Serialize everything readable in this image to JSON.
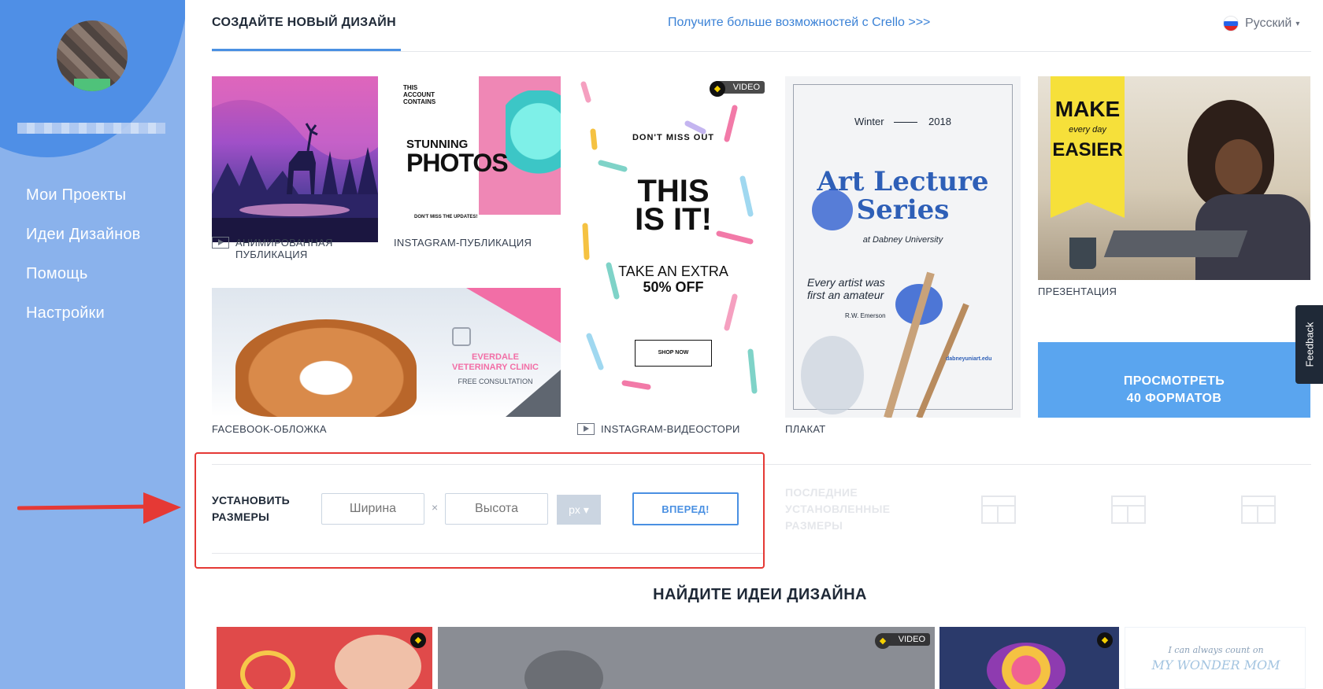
{
  "sidebar": {
    "nav": [
      "Мои Проекты",
      "Идеи Дизайнов",
      "Помощь",
      "Настройки"
    ]
  },
  "header": {
    "tab_label": "СОЗДАЙТЕ НОВЫЙ ДИЗАЙН",
    "upgrade_link": "Получите больше возможностей с Crello >>>",
    "language": "Русский"
  },
  "templates": {
    "animated": {
      "caption_line1": "АНИМИРОВАННАЯ",
      "caption_line2": "ПУБЛИКАЦИЯ"
    },
    "instagram": {
      "caption": "INSTAGRAM-ПУБЛИКАЦИЯ",
      "text_small": "THIS ACCOUNT CONTAINS",
      "text_stunning": "STUNNING",
      "text_photos": "PHOTOS",
      "text_footer": "DON'T MISS THE UPDATES!"
    },
    "story": {
      "caption": "INSTAGRAM-ВИДЕОСТОРИ",
      "badge": "VIDEO",
      "dont_miss": "DON'T MISS OUT",
      "headline1": "THIS",
      "headline2": "IS IT!",
      "offer1": "TAKE AN EXTRA",
      "offer2": "50% OFF",
      "shop": "SHOP NOW"
    },
    "poster": {
      "caption": "ПЛАКАТ",
      "season": "Winter",
      "year": "2018",
      "title1": "Art Lecture",
      "title2": "Series",
      "university": "at Dabney University",
      "quote1": "Every artist was",
      "quote2": "first an amateur",
      "author": "R.W. Emerson",
      "site": "dabneyuniart.edu"
    },
    "presentation": {
      "caption": "ПРЕЗЕНТАЦИЯ",
      "sign1": "MAKE",
      "sign2": "every day",
      "sign3": "EASIER"
    },
    "facebook": {
      "caption": "FACEBOOK-ОБЛОЖКА",
      "clinic1": "EVERDALE",
      "clinic2": "VETERINARY CLINIC",
      "consult": "FREE CONSULTATION"
    }
  },
  "view_formats": {
    "line1": "ПРОСМОТРЕТЬ",
    "line2": "40 ФОРМАТОВ"
  },
  "feedback": "Feedback",
  "custom_size": {
    "label_line1": "УСТАНОВИТЬ",
    "label_line2": "РАЗМЕРЫ",
    "width_placeholder": "Ширина",
    "height_placeholder": "Высота",
    "times": "×",
    "unit": "px ▾",
    "go": "ВПЕРЕД!",
    "recent_line1": "ПОСЛЕДНИЕ",
    "recent_line2": "УСТАНОВЛЕННЫЕ",
    "recent_line3": "РАЗМЕРЫ"
  },
  "ideas": {
    "title": "НАЙДИТЕ ИДЕИ ДИЗАЙНА",
    "video_badge": "VIDEO",
    "mom_line1": "I can always count on",
    "mom_line2": "MY WONDER MOM"
  },
  "colors": {
    "accent": "#4a90e2",
    "sidebar": "#8ab2ec",
    "highlight": "#e53935"
  }
}
